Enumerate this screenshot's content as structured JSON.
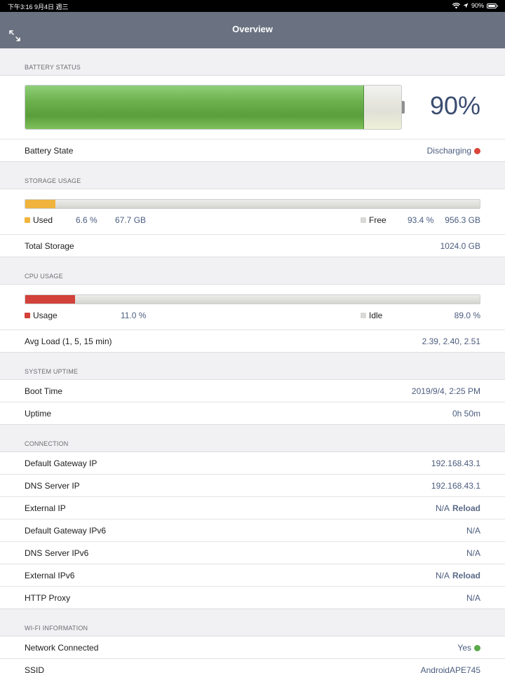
{
  "statusbar": {
    "time_date": "下午3:16  9月4日 週三",
    "battery_text": "90%"
  },
  "nav": {
    "title": "Overview"
  },
  "battery": {
    "header": "BATTERY STATUS",
    "level_fraction": 0.9,
    "percent_text": "90%",
    "state_label": "Battery State",
    "state_value": "Discharging",
    "state_color": "#d9453a"
  },
  "storage": {
    "header": "STORAGE USAGE",
    "used_fraction": 0.066,
    "used_color": "#f0b43c",
    "used_label": "Used",
    "used_pct": "6.6 %",
    "used_size": "67.7 GB",
    "free_label": "Free",
    "free_pct": "93.4 %",
    "free_size": "956.3 GB",
    "total_label": "Total Storage",
    "total_value": "1024.0 GB"
  },
  "cpu": {
    "header": "CPU USAGE",
    "usage_fraction": 0.11,
    "usage_color": "#d2413a",
    "usage_label": "Usage",
    "usage_pct": "11.0 %",
    "idle_label": "Idle",
    "idle_pct": "89.0 %",
    "load_label": "Avg Load (1, 5, 15 min)",
    "load_value": "2.39, 2.40, 2.51"
  },
  "uptime": {
    "header": "SYSTEM UPTIME",
    "boot_label": "Boot Time",
    "boot_value": "2019/9/4, 2:25 PM",
    "uptime_label": "Uptime",
    "uptime_value": "0h 50m"
  },
  "connection": {
    "header": "CONNECTION",
    "gateway_label": "Default Gateway IP",
    "gateway_value": "192.168.43.1",
    "dns_label": "DNS Server IP",
    "dns_value": "192.168.43.1",
    "external_label": "External IP",
    "external_value": "N/A",
    "external_reload": "Reload",
    "gateway6_label": "Default Gateway IPv6",
    "gateway6_value": "N/A",
    "dns6_label": "DNS Server IPv6",
    "dns6_value": "N/A",
    "external6_label": "External IPv6",
    "external6_value": "N/A",
    "external6_reload": "Reload",
    "proxy_label": "HTTP Proxy",
    "proxy_value": "N/A"
  },
  "wifi": {
    "header": "WI-FI INFORMATION",
    "connected_label": "Network Connected",
    "connected_value": "Yes",
    "connected_color": "#5aa84a",
    "ssid_label": "SSID",
    "ssid_value": "AndroidAPE745"
  },
  "icons": {
    "expand": "expand-arrows-icon",
    "wifi": "wifi-icon",
    "location": "location-arrow-icon",
    "battery": "battery-icon"
  }
}
